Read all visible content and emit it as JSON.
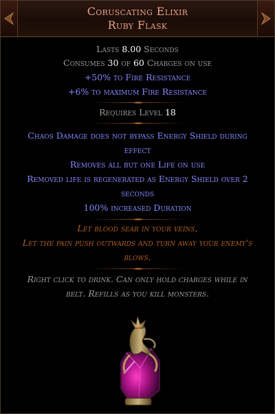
{
  "item": {
    "name": "Coruscating Elixir",
    "base_type": "Ruby Flask"
  },
  "properties": {
    "lasts_prefix": "Lasts ",
    "lasts_value": "8.00",
    "lasts_suffix": " Seconds",
    "consumes_prefix": "Consumes ",
    "consumes_used": "30",
    "consumes_mid": " of ",
    "consumes_total": "60",
    "consumes_suffix": " Charges on use",
    "implicit_1": "+50% to Fire Resistance",
    "implicit_2": "+6% to maximum Fire Resistance"
  },
  "requirements": {
    "prefix": "Requires Level ",
    "level": "18"
  },
  "explicit_mods": {
    "mod_1_line_1": "Chaos Damage does not bypass Energy Shield during",
    "mod_1_line_2": "effect",
    "mod_2": "Removes all but one Life on use",
    "mod_3_line_1": "Removed life is regenerated as Energy Shield over 2",
    "mod_3_line_2": "seconds",
    "mod_4": "100% increased Duration"
  },
  "flavour_text": {
    "line_1": "Let blood sear in your veins,",
    "line_2": "Let the pain push outwards and turn away your enemy's",
    "line_3": "blows."
  },
  "help_text": {
    "line_1": "Right click to drink. Can only hold charges while in",
    "line_2": "belt. Refills as you kill monsters."
  },
  "colors": {
    "unique_name": "#e8a38a",
    "magic_mod": "#8888ff",
    "flavour": "#af6025",
    "default_text": "#9c9c9c",
    "value_white": "#ffffff"
  },
  "icons": {
    "flask_art": "dragon-flask-icon",
    "header_ornament": "unique-header-ornament-icon"
  }
}
